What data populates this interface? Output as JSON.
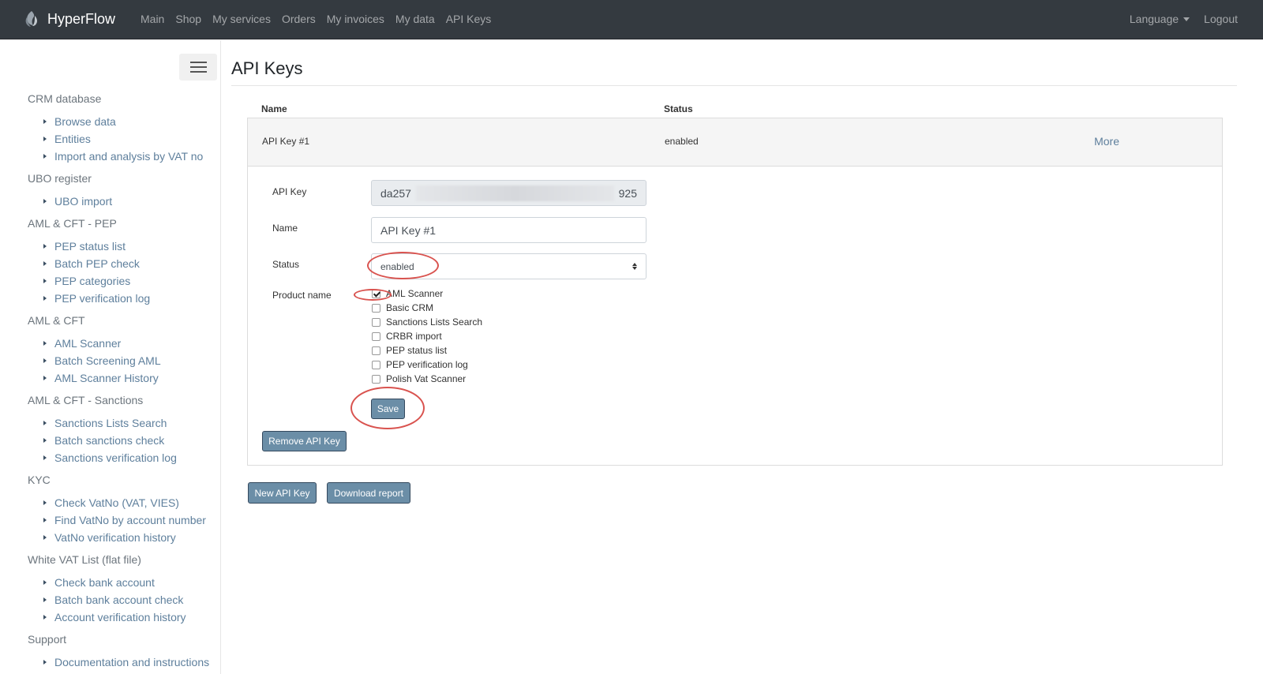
{
  "navbar": {
    "brand": "HyperFlow",
    "links": [
      "Main",
      "Shop",
      "My services",
      "Orders",
      "My invoices",
      "My data",
      "API Keys"
    ],
    "language": "Language",
    "logout": "Logout"
  },
  "sidebar": {
    "groups": [
      {
        "title": "CRM database",
        "items": [
          "Browse data",
          "Entities",
          "Import and analysis by VAT no"
        ]
      },
      {
        "title": "UBO register",
        "items": [
          "UBO import"
        ]
      },
      {
        "title": "AML & CFT - PEP",
        "items": [
          "PEP status list",
          "Batch PEP check",
          "PEP categories",
          "PEP verification log"
        ]
      },
      {
        "title": "AML & CFT",
        "items": [
          "AML Scanner",
          "Batch Screening AML",
          "AML Scanner History"
        ]
      },
      {
        "title": "AML & CFT - Sanctions",
        "items": [
          "Sanctions Lists Search",
          "Batch sanctions check",
          "Sanctions verification log"
        ]
      },
      {
        "title": "KYC",
        "items": [
          "Check VatNo (VAT, VIES)",
          "Find VatNo by account number",
          "VatNo verification history"
        ]
      },
      {
        "title": "White VAT List (flat file)",
        "items": [
          "Check bank account",
          "Batch bank account check",
          "Account verification history"
        ]
      },
      {
        "title": "Support",
        "items": [
          "Documentation and instructions"
        ]
      }
    ]
  },
  "main": {
    "title": "API Keys",
    "table": {
      "headers": {
        "name": "Name",
        "status": "Status"
      },
      "row": {
        "name": "API Key #1",
        "status": "enabled",
        "more": "More"
      }
    },
    "form": {
      "api_key_label": "API Key",
      "api_key_prefix": "da257",
      "api_key_suffix": "925",
      "name_label": "Name",
      "name_value": "API Key #1",
      "status_label": "Status",
      "status_value": "enabled",
      "product_label": "Product name",
      "products": [
        {
          "label": "AML Scanner",
          "checked": true
        },
        {
          "label": "Basic CRM",
          "checked": false
        },
        {
          "label": "Sanctions Lists Search",
          "checked": false
        },
        {
          "label": "CRBR import",
          "checked": false
        },
        {
          "label": "PEP status list",
          "checked": false
        },
        {
          "label": "PEP verification log",
          "checked": false
        },
        {
          "label": "Polish Vat Scanner",
          "checked": false
        }
      ],
      "save": "Save",
      "remove": "Remove API Key"
    },
    "actions": {
      "new_key": "New API Key",
      "download": "Download report"
    }
  },
  "colors": {
    "navbar": "#343a40",
    "link": "#5e7f9c",
    "button": "#6b8ea7",
    "annotation": "#d9534f"
  }
}
